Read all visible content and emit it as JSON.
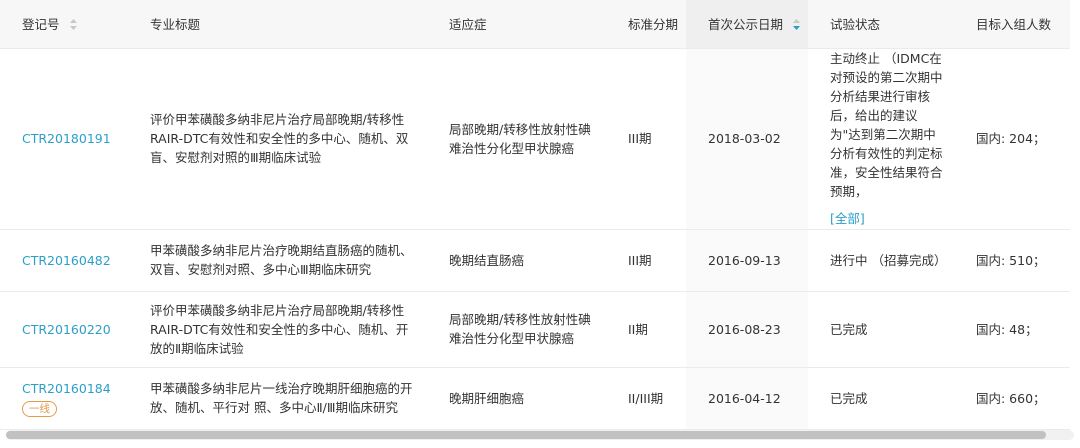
{
  "table": {
    "headers": {
      "reg_no": "登记号",
      "title": "专业标题",
      "indication": "适应症",
      "stage": "标准分期",
      "first_date": "首次公示日期",
      "status": "试验状态",
      "target": "目标入组人数"
    },
    "rows": [
      {
        "reg_no": "CTR20180191",
        "title": "评价甲苯磺酸多纳非尼片治疗局部晚期/转移性RAIR-DTC有效性和安全性的多中心、随机、双盲、安慰剂对照的Ⅲ期临床试验",
        "indication": "局部晚期/转移性放射性碘难治性分化型甲状腺癌",
        "stage": "III期",
        "first_date": "2018-03-02",
        "status": "主动终止 （IDMC在对预设的第二次期中分析结果进行审核后，给出的建议为\"达到第二次期中分析有效性的判定标准，安全性结果符合预期，",
        "status_more": "[全部]",
        "target": "国内: 204；"
      },
      {
        "reg_no": "CTR20160482",
        "title": "甲苯磺酸多纳非尼片治疗晚期结直肠癌的随机、双盲、安慰剂对照、多中心Ⅲ期临床研究",
        "indication": "晚期结直肠癌",
        "stage": "III期",
        "first_date": "2016-09-13",
        "status": "进行中 （招募完成）",
        "target": "国内: 510；"
      },
      {
        "reg_no": "CTR20160220",
        "title": "评价甲苯磺酸多纳非尼片治疗局部晚期/转移性RAIR-DTC有效性和安全性的多中心、随机、开放的Ⅱ期临床试验",
        "indication": "局部晚期/转移性放射性碘难治性分化型甲状腺癌",
        "stage": "II期",
        "first_date": "2016-08-23",
        "status": "已完成",
        "target": "国内: 48；"
      },
      {
        "reg_no": "CTR20160184",
        "badge": "一线",
        "title": "甲苯磺酸多纳非尼片一线治疗晚期肝细胞癌的开放、随机、平行对 照、多中心Ⅱ/Ⅲ期临床研究",
        "indication": "晚期肝细胞癌",
        "stage": "II/III期",
        "first_date": "2016-04-12",
        "status": "已完成",
        "target": "国内: 660；"
      }
    ]
  },
  "colors": {
    "link": "#2b9fc9",
    "badge": "#e59a4a",
    "sort_active": "#2b9fc9",
    "sort_inactive": "#c8c8c8"
  },
  "icons": {
    "reg_no_sort": "sort-icon",
    "date_sort": "sort-descending-icon"
  }
}
